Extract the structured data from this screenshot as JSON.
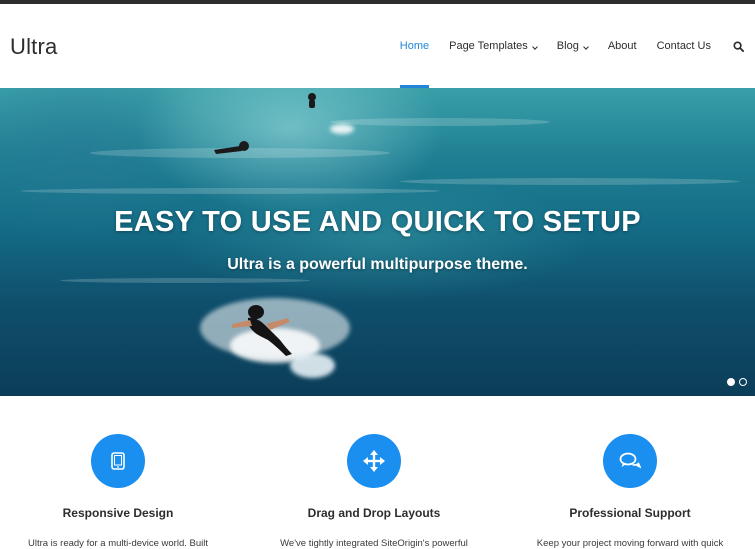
{
  "site": {
    "logo": "Ultra"
  },
  "nav": {
    "items": [
      {
        "label": "Home",
        "active": true,
        "dropdown": false
      },
      {
        "label": "Page Templates",
        "active": false,
        "dropdown": true
      },
      {
        "label": "Blog",
        "active": false,
        "dropdown": true
      },
      {
        "label": "About",
        "active": false,
        "dropdown": false
      },
      {
        "label": "Contact Us",
        "active": false,
        "dropdown": false
      }
    ],
    "search_icon": "search-icon"
  },
  "hero": {
    "title": "EASY TO USE AND QUICK TO SETUP",
    "subtitle": "Ultra is a powerful multipurpose theme.",
    "slides": 2,
    "active_slide": 1
  },
  "features": [
    {
      "icon": "tablet-icon",
      "title": "Responsive Design",
      "desc": "Ultra is ready for a multi-device world. Built"
    },
    {
      "icon": "move-arrows-icon",
      "title": "Drag and Drop Layouts",
      "desc": "We've tightly integrated SiteOrigin's powerful"
    },
    {
      "icon": "chat-bubbles-icon",
      "title": "Professional Support",
      "desc": "Keep your project moving forward with quick"
    }
  ],
  "colors": {
    "accent": "#2186d8",
    "icon_circle": "#1a8ff0",
    "topbar": "#2d2d2d"
  }
}
